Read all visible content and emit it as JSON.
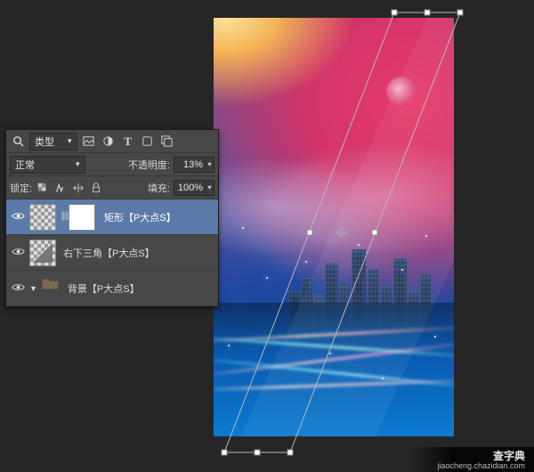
{
  "panel": {
    "kind_label": "类型",
    "blend_label": "正常",
    "opacity_label": "不透明度:",
    "opacity_value": "13%",
    "lock_label": "锁定:",
    "fill_label": "填充:",
    "fill_value": "100%"
  },
  "layers": [
    {
      "name": "矩形【P大点S】",
      "selected": true,
      "has_mask": true,
      "type": "shape"
    },
    {
      "name": "右下三角【P大点S】",
      "selected": false,
      "has_mask": false,
      "type": "shape"
    },
    {
      "name": "背景【P大点S】",
      "selected": false,
      "has_mask": false,
      "type": "group"
    }
  ],
  "watermark": {
    "title": "查字典",
    "url": "jiaocheng.chazidian.com"
  },
  "icons": {
    "search": "search-icon",
    "image": "image-filter-icon",
    "adjust": "adjustment-filter-icon",
    "type": "type-filter-icon",
    "shape": "shape-filter-icon",
    "smart": "smartobject-filter-icon",
    "eye": "visibility-icon",
    "folder": "folder-icon"
  }
}
